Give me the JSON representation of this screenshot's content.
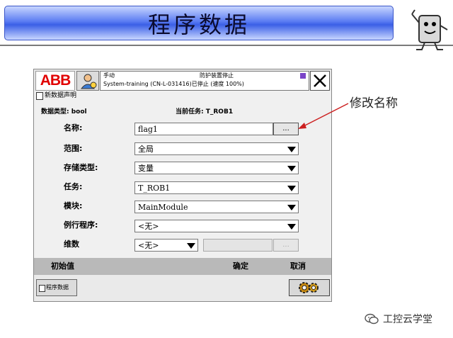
{
  "slide": {
    "title": "程序数据"
  },
  "annotation": {
    "text": "修改名称"
  },
  "watermark": {
    "text": "工控云学堂"
  },
  "pendant": {
    "logo": "ABB",
    "status": {
      "mode": "手动",
      "motor_state": "防护装置停止",
      "system": "System-training (CN-L-031416)",
      "state_line": "已停止 (速度 100%)"
    },
    "subheader": "新数据声明",
    "info": {
      "data_type_label": "数据类型: bool",
      "current_task_label": "当前任务:  T_ROB1"
    },
    "fields": {
      "name": {
        "label": "名称:",
        "value": "flag1",
        "button": "..."
      },
      "scope": {
        "label": "范围:",
        "value": "全局"
      },
      "storage": {
        "label": "存储类型:",
        "value": "变量"
      },
      "task": {
        "label": "任务:",
        "value": "T_ROB1"
      },
      "module": {
        "label": "模块:",
        "value": "MainModule"
      },
      "routine": {
        "label": "例行程序:",
        "value": "<无>"
      },
      "dimension": {
        "label": "维数",
        "value": "<无>",
        "button": "..."
      }
    },
    "commands": {
      "init": "初始值",
      "ok": "确定",
      "cancel": "取消"
    },
    "taskbar": {
      "program_data": "程序数据"
    },
    "colors": {
      "logo_red": "#e10000",
      "banner_blue": "#3b5fe6",
      "arrow_red": "#cc2020"
    }
  }
}
